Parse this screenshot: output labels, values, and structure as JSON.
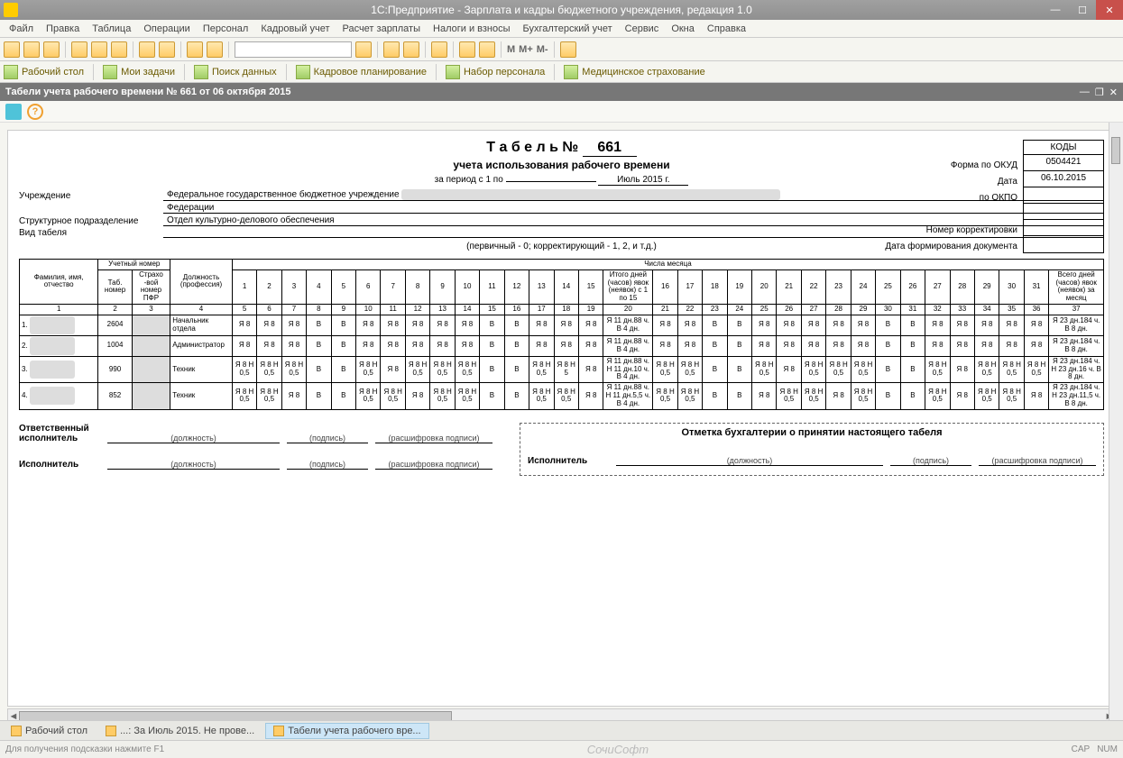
{
  "app_title": "1С:Предприятие - Зарплата и кадры бюджетного учреждения, редакция 1.0",
  "menu": [
    "Файл",
    "Правка",
    "Таблица",
    "Операции",
    "Персонал",
    "Кадровый учет",
    "Расчет зарплаты",
    "Налоги и взносы",
    "Бухгалтерский учет",
    "Сервис",
    "Окна",
    "Справка"
  ],
  "toolbar1_m": [
    "M",
    "M+",
    "M-"
  ],
  "nav": [
    {
      "label": "Рабочий стол"
    },
    {
      "label": "Мои задачи"
    },
    {
      "label": "Поиск данных"
    },
    {
      "label": "Кадровое планирование"
    },
    {
      "label": "Набор персонала"
    },
    {
      "label": "Медицинское страхование"
    }
  ],
  "doc_tab": "Табели учета рабочего времени № 661 от 06 октября 2015",
  "report": {
    "title": "Т а б е л ь №",
    "number": "661",
    "subtitle": "учета использования рабочего времени",
    "period_label": "за период с 1 по",
    "period_value": "Июль 2015 г.",
    "inst_label": "Учреждение",
    "inst_value": "Федеральное государственное бюджетное учреждение",
    "inst_value2": "Федерации",
    "dept_label": "Структурное подразделение",
    "dept_value": "Отдел культурно-делового обеспечения",
    "type_label": "Вид табеля",
    "note": "(первичный - 0; корректирующий - 1, 2, и т.д.)",
    "codes_header": "КОДЫ",
    "codes_labels": [
      "Форма по ОКУД",
      "Дата",
      "по ОКПО",
      "",
      "Номер корректировки",
      "Дата формирования документа"
    ],
    "codes_values": [
      "0504421",
      "06.10.2015",
      "",
      "",
      "",
      ""
    ],
    "col_fio": "Фамилия, имя, отчество",
    "col_uch": "Учетный номер",
    "col_tab": "Таб. номер",
    "col_pfr": "Страхо -вой номер ПФР",
    "col_pos": "Должность (профессия)",
    "col_days": "Числа месяца",
    "col_mid": "Итого дней (часов) явок (неявок) с 1 по 15",
    "col_total": "Всего дней (часов) явок (неявок) за месяц",
    "colnums": [
      "1",
      "2",
      "3",
      "4",
      "5",
      "6",
      "7",
      "8",
      "9",
      "10",
      "11",
      "12",
      "13",
      "14",
      "15",
      "16",
      "17",
      "18",
      "19",
      "20",
      "21",
      "22",
      "23",
      "24",
      "25",
      "26",
      "27",
      "28",
      "29",
      "30",
      "31",
      "32",
      "33",
      "34",
      "35",
      "36",
      "37"
    ]
  },
  "rows": [
    {
      "n": "1",
      "tab": "2604",
      "pos": "Начальник отдела",
      "d": [
        "Я 8",
        "Я 8",
        "Я 8",
        "В",
        "В",
        "Я 8",
        "Я 8",
        "Я 8",
        "Я 8",
        "Я 8",
        "В",
        "В",
        "Я 8",
        "Я 8",
        "Я 8"
      ],
      "mid": "Я 11 дн.88 ч. В 4 дн.",
      "d2": [
        "Я 8",
        "Я 8",
        "В",
        "В",
        "Я 8",
        "Я 8",
        "Я 8",
        "Я 8",
        "Я 8",
        "В",
        "В",
        "Я 8",
        "Я 8",
        "Я 8",
        "Я 8",
        "Я 8"
      ],
      "tot": "Я 23 дн.184 ч. В 8 дн."
    },
    {
      "n": "2",
      "tab": "1004",
      "pos": "Администратор",
      "d": [
        "Я 8",
        "Я 8",
        "Я 8",
        "В",
        "В",
        "Я 8",
        "Я 8",
        "Я 8",
        "Я 8",
        "Я 8",
        "В",
        "В",
        "Я 8",
        "Я 8",
        "Я 8"
      ],
      "mid": "Я 11 дн.88 ч. В 4 дн.",
      "d2": [
        "Я 8",
        "Я 8",
        "В",
        "В",
        "Я 8",
        "Я 8",
        "Я 8",
        "Я 8",
        "Я 8",
        "В",
        "В",
        "Я 8",
        "Я 8",
        "Я 8",
        "Я 8",
        "Я 8"
      ],
      "tot": "Я 23 дн.184 ч. В 8 дн."
    },
    {
      "n": "3",
      "tab": "990",
      "pos": "Техник",
      "d": [
        "Я 8 Н 0,5",
        "Я 8 Н 0,5",
        "Я 8 Н 0,5",
        "В",
        "В",
        "Я 8 Н 0,5",
        "Я 8",
        "Я 8 Н 0,5",
        "Я 8 Н 0,5",
        "Я 8 Н 0,5",
        "В",
        "В",
        "Я 8 Н 0,5",
        "Я 8 Н 5",
        "Я 8"
      ],
      "mid": "Я 11 дн.88 ч. Н 11 дн.10 ч. В 4 дн.",
      "d2": [
        "Я 8 Н 0,5",
        "Я 8 Н 0,5",
        "В",
        "В",
        "Я 8 Н 0,5",
        "Я 8",
        "Я 8 Н 0,5",
        "Я 8 Н 0,5",
        "Я 8 Н 0,5",
        "В",
        "В",
        "Я 8 Н 0,5",
        "Я 8",
        "Я 8 Н 0,5",
        "Я 8 Н 0,5",
        "Я 8 Н 0,5"
      ],
      "tot": "Я 23 дн.184 ч. Н 23 дн.16 ч. В 8 дн."
    },
    {
      "n": "4",
      "tab": "852",
      "pos": "Техник",
      "d": [
        "Я 8 Н 0,5",
        "Я 8 Н 0,5",
        "Я 8",
        "В",
        "В",
        "Я 8 Н 0,5",
        "Я 8 Н 0,5",
        "Я 8",
        "Я 8 Н 0,5",
        "Я 8 Н 0,5",
        "В",
        "В",
        "Я 8 Н 0,5",
        "Я 8 Н 0,5",
        "Я 8"
      ],
      "mid": "Я 11 дн.88 ч. Н 11 дн.5,5 ч. В 4 дн.",
      "d2": [
        "Я 8 Н 0,5",
        "Я 8 Н 0,5",
        "В",
        "В",
        "Я 8",
        "Я 8 Н 0,5",
        "Я 8 Н 0,5",
        "Я 8",
        "Я 8 Н 0,5",
        "В",
        "В",
        "Я 8 Н 0,5",
        "Я 8",
        "Я 8 Н 0,5",
        "Я 8 Н 0,5",
        "Я 8"
      ],
      "tot": "Я 23 дн.184 ч. Н 23 дн.11,5 ч. В 8 дн."
    }
  ],
  "sign": {
    "resp": "Ответственный исполнитель",
    "exec": "Исполнитель",
    "pos": "(должность)",
    "sig": "(подпись)",
    "dec": "(расшифровка подписи)",
    "acc_title": "Отметка бухгалтерии о принятии настоящего табеля",
    "acc_exec": "Исполнитель"
  },
  "bottom_tabs": [
    {
      "label": "Рабочий стол",
      "active": false
    },
    {
      "label": "...: За Июль 2015. Не прове...",
      "active": false
    },
    {
      "label": "Табели учета рабочего вре...",
      "active": true
    }
  ],
  "status": {
    "hint": "Для получения подсказки нажмите F1",
    "logo": "СочиСофт",
    "cap": "CAP",
    "num": "NUM"
  }
}
